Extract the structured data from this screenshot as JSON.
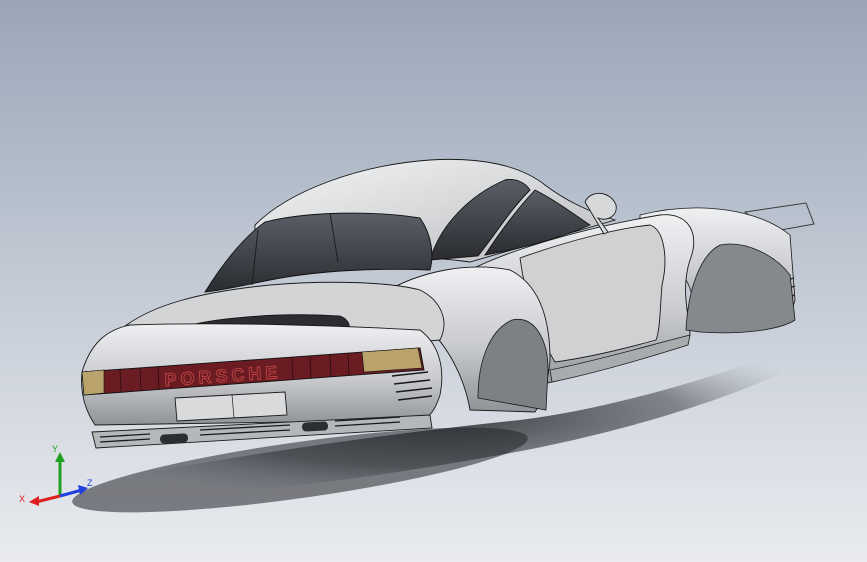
{
  "window": {
    "title": ""
  },
  "viewport": {
    "background_top": "#9aa6b8",
    "background_bottom": "#e9ebef",
    "model": {
      "name": "car-body",
      "badge_text": "PORSCHE",
      "colors": {
        "body": "#c9cacc",
        "body_shadow": "#8e9093",
        "edge": "#1a1a1a",
        "glass": "#3c3f45",
        "taillight_red": "#6a1c22",
        "taillight_amber": "#b9a36b",
        "ground_shadow": "#2b2d31"
      }
    },
    "triad": {
      "x_label": "X",
      "y_label": "Y",
      "z_label": "Z",
      "x_color": "#e02020",
      "y_color": "#20a020",
      "z_color": "#2040e0"
    }
  }
}
